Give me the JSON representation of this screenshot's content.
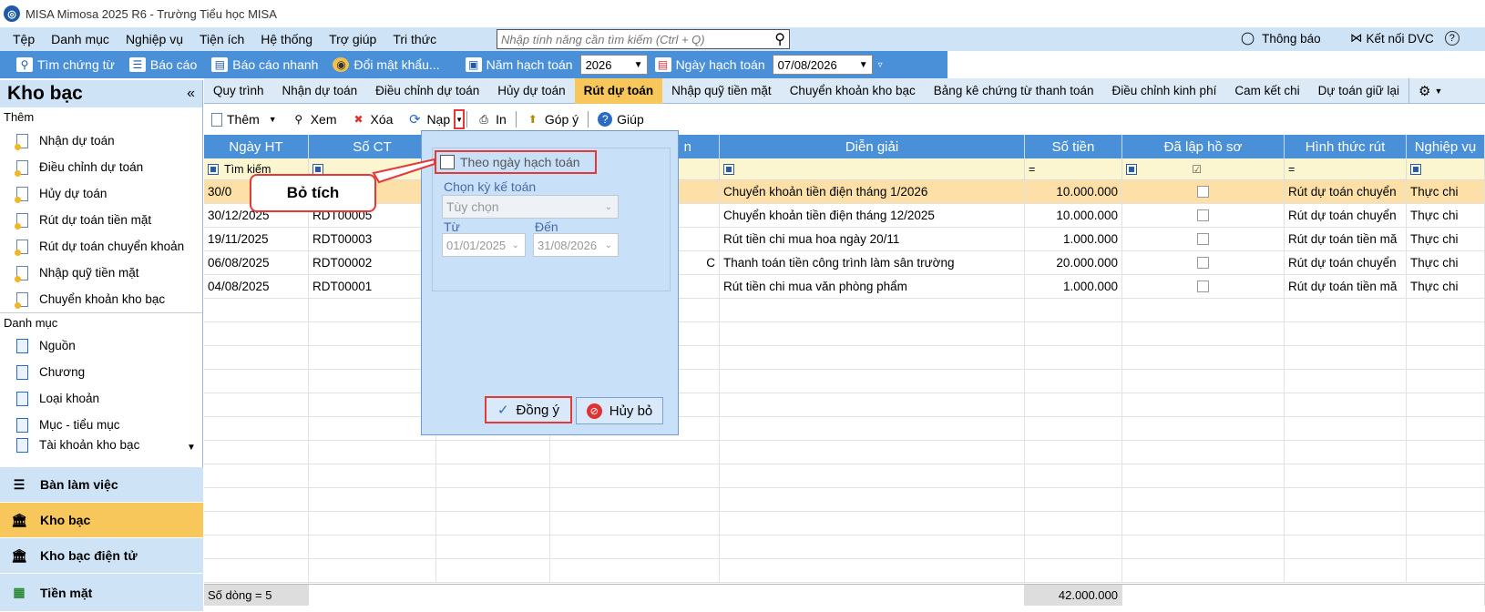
{
  "window": {
    "title": "MISA Mimosa 2025 R6 - Trường Tiểu học MISA"
  },
  "menu": {
    "items": [
      "Tệp",
      "Danh mục",
      "Nghiệp vụ",
      "Tiện ích",
      "Hệ thống",
      "Trợ giúp",
      "Tri thức"
    ],
    "search_placeholder": "Nhập tính năng cần tìm kiếm (Ctrl + Q)",
    "notify": "Thông báo",
    "connect": "Kết nối DVC"
  },
  "toolbar": {
    "find": "Tìm chứng từ",
    "report": "Báo cáo",
    "quick_report": "Báo cáo nhanh",
    "change_pw": "Đổi mật khẩu...",
    "fiscal_year_label": "Năm hạch toán",
    "fiscal_year": "2026",
    "post_date_label": "Ngày hạch toán",
    "post_date": "07/08/2026"
  },
  "sidebar": {
    "title": "Kho bạc",
    "collapse": "«",
    "section_add": "Thêm",
    "add_items": [
      "Nhận dự toán",
      "Điều chỉnh dự toán",
      "Hủy dự toán",
      "Rút dự toán tiền mặt",
      "Rút dự toán chuyển khoản",
      "Nhập quỹ tiền mặt",
      "Chuyển khoản kho bạc"
    ],
    "section_cat": "Danh mục",
    "cat_items": [
      "Nguồn",
      "Chương",
      "Loại khoản",
      "Mục - tiểu mục",
      "Tài khoản kho bạc"
    ],
    "modules": [
      "Bàn làm việc",
      "Kho bạc",
      "Kho bạc điện tử",
      "Tiền mặt"
    ]
  },
  "tabs": [
    "Quy trình",
    "Nhận dự toán",
    "Điều chỉnh dự toán",
    "Hủy dự toán",
    "Rút dự toán",
    "Nhập quỹ tiền mặt",
    "Chuyển khoản kho bạc",
    "Bảng kê chứng từ thanh toán",
    "Điều chỉnh kinh phí",
    "Cam kết chi",
    "Dự toán giữ lại"
  ],
  "actions": {
    "add": "Thêm",
    "view": "Xem",
    "delete": "Xóa",
    "load": "Nạp",
    "print": "In",
    "feedback": "Góp ý",
    "help": "Giúp"
  },
  "grid": {
    "headers": [
      "Ngày HT",
      "Số CT",
      "",
      "n",
      "Diễn giải",
      "Số tiền",
      "Đã lập hồ sơ",
      "Hình thức rút",
      "Nghiệp vụ"
    ],
    "filter_text": "Tìm kiếm",
    "rows": [
      {
        "date": "30/0",
        "no": "",
        "c3": "",
        "c4": "",
        "desc": "Chuyển khoản tiền điện tháng 1/2026",
        "amount": "10.000.000",
        "method": "Rút dự toán chuyển",
        "type": "Thực chi"
      },
      {
        "date": "30/12/2025",
        "no": "RDT00005",
        "c3": "",
        "c4": "",
        "desc": "Chuyển khoản tiền điện tháng 12/2025",
        "amount": "10.000.000",
        "method": "Rút dự toán chuyển",
        "type": "Thực chi"
      },
      {
        "date": "19/11/2025",
        "no": "RDT00003",
        "c3": "",
        "c4": "",
        "desc": "Rút tiền chi mua hoa ngày 20/11",
        "amount": "1.000.000",
        "method": "Rút dự toán tiền mă",
        "type": "Thực chi"
      },
      {
        "date": "06/08/2025",
        "no": "RDT00002",
        "c3": "",
        "c4": "C",
        "desc": "Thanh toán tiền công trình làm sân trường",
        "amount": "20.000.000",
        "method": "Rút dự toán chuyển",
        "type": "Thực chi"
      },
      {
        "date": "04/08/2025",
        "no": "RDT00001",
        "c3": "",
        "c4": "",
        "desc": "Rút tiền chi mua văn phòng phẩm",
        "amount": "1.000.000",
        "method": "Rút dự toán tiền mă",
        "type": "Thực chi"
      }
    ],
    "footer_count": "Số dòng = 5",
    "footer_total": "42.000.000"
  },
  "popup": {
    "checkbox_label": "Theo ngày hạch toán",
    "period_label": "Chọn kỳ kế toán",
    "period_value": "Tùy chọn",
    "from_label": "Từ",
    "to_label": "Đến",
    "from_value": "01/01/2025",
    "to_value": "31/08/2026",
    "ok": "Đồng ý",
    "cancel": "Hủy bỏ"
  },
  "callout": "Bỏ tích"
}
